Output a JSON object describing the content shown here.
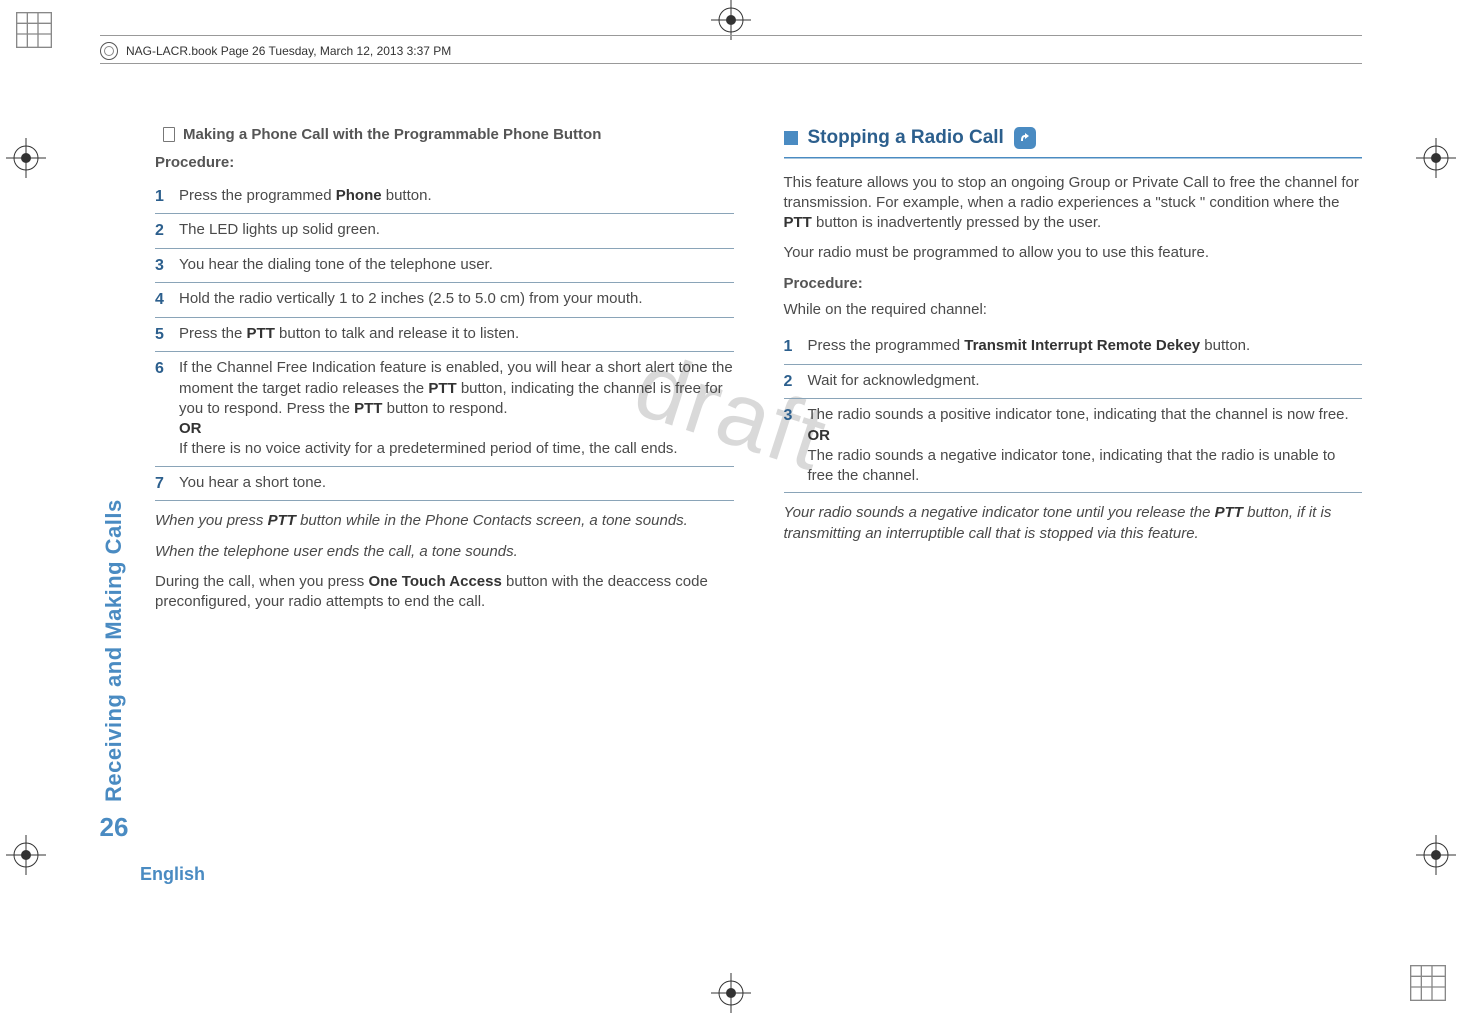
{
  "header": {
    "book_info": "NAG-LACR.book  Page 26  Tuesday, March 12, 2013  3:37 PM"
  },
  "sidebar": {
    "section_label": "Receiving and Making Calls",
    "page_number": "26",
    "language": "English"
  },
  "watermark": "draft",
  "left": {
    "heading": "Making a Phone Call with the Programmable Phone Button",
    "procedure_label": "Procedure:",
    "steps": [
      {
        "n": "1",
        "html": "Press the programmed <b>Phone</b> button."
      },
      {
        "n": "2",
        "html": "The LED lights up solid green."
      },
      {
        "n": "3",
        "html": "You hear the dialing tone of the telephone user."
      },
      {
        "n": "4",
        "html": "Hold the radio vertically 1 to 2 inches (2.5 to 5.0 cm) from your mouth."
      },
      {
        "n": "5",
        "html": "Press the <b>PTT</b> button to talk and release it to listen."
      },
      {
        "n": "6",
        "html": "If the Channel Free Indication feature is enabled, you will hear a short alert tone the moment the target radio releases the <b>PTT</b> button, indicating the channel is free for you to respond. Press the <b>PTT</b> button to respond.<br><b>OR</b><br>If there is no voice activity for a predetermined period of time, the call ends."
      },
      {
        "n": "7",
        "html": "You hear a short tone."
      }
    ],
    "after": [
      {
        "cls": "italic",
        "html": "When you press <b>PTT</b> button while in the Phone Contacts screen, a tone sounds."
      },
      {
        "cls": "italic",
        "html": "When the telephone user ends the call, a tone sounds."
      },
      {
        "cls": "",
        "html": "During the call, when you press <b>One Touch Access</b> button with the deaccess code preconfigured, your radio attempts to end the call."
      }
    ]
  },
  "right": {
    "heading": "Stopping a Radio Call",
    "intro": [
      {
        "html": "This feature allows you to stop an ongoing Group or Private Call to free the channel for transmission. For example, when a radio experiences a \"stuck \" condition where the <b>PTT</b> button is inadvertently pressed by the user."
      },
      {
        "html": "Your radio must be programmed to allow you to use this feature."
      }
    ],
    "procedure_label": "Procedure:",
    "procedure_sub": "While on the required channel:",
    "steps": [
      {
        "n": "1",
        "html": "Press the programmed <b>Transmit Interrupt Remote Dekey</b> button."
      },
      {
        "n": "2",
        "html": "Wait for acknowledgment."
      },
      {
        "n": "3",
        "html": "The radio sounds a positive indicator tone, indicating that the channel is now free.<br><b>OR</b><br>The radio sounds a negative indicator tone, indicating that the radio is unable to free the channel."
      }
    ],
    "after": [
      {
        "cls": "italic",
        "html": "Your radio sounds a negative indicator tone until you release the <b>PTT</b> button, if it is transmitting an interruptible call that is stopped via this feature."
      }
    ]
  }
}
